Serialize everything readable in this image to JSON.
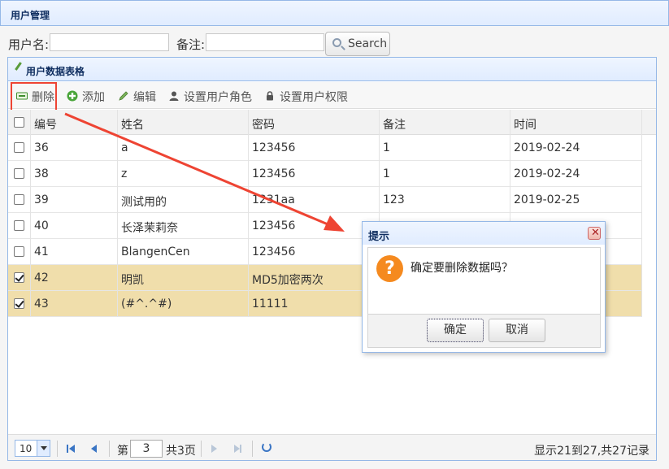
{
  "page": {
    "title": "用户管理"
  },
  "search": {
    "username_label": "用户名:",
    "username_value": "",
    "remark_label": "备注:",
    "remark_value": "",
    "button_label": "Search"
  },
  "grid": {
    "title": "用户数据表格",
    "toolbar": {
      "delete": "删除",
      "add": "添加",
      "edit": "编辑",
      "set_role": "设置用户角色",
      "set_perm": "设置用户权限"
    },
    "columns": [
      "编号",
      "姓名",
      "密码",
      "备注",
      "时间"
    ],
    "rows": [
      {
        "id": "36",
        "name": "a",
        "password": "123456",
        "remark": "1",
        "time": "2019-02-24",
        "checked": false
      },
      {
        "id": "38",
        "name": "z",
        "password": "123456",
        "remark": "1",
        "time": "2019-02-24",
        "checked": false
      },
      {
        "id": "39",
        "name": "测试用的",
        "password": "1231aa",
        "remark": "123",
        "time": "2019-02-25",
        "checked": false
      },
      {
        "id": "40",
        "name": "长泽茉莉奈",
        "password": "123456",
        "remark": "",
        "time": "",
        "checked": false
      },
      {
        "id": "41",
        "name": "BlangenCen",
        "password": "123456",
        "remark": "",
        "time": "",
        "checked": false
      },
      {
        "id": "42",
        "name": "明凯",
        "password": "MD5加密两次",
        "remark": "",
        "time": "",
        "checked": true
      },
      {
        "id": "43",
        "name": "(#^.^#)",
        "password": "11111",
        "remark": "",
        "time": "",
        "checked": true
      }
    ],
    "pager": {
      "page_size": "10",
      "page_prefix": "第",
      "page_current": "3",
      "page_suffix": "共3页",
      "info": "显示21到27,共27记录"
    }
  },
  "dialog": {
    "title": "提示",
    "message": "确定要删除数据吗？",
    "ok": "确定",
    "cancel": "取消"
  },
  "colors": {
    "header_border": "#95b8e7",
    "selected_row": "#f0deab",
    "annotation": "#e43",
    "question": "#f58a1f"
  }
}
